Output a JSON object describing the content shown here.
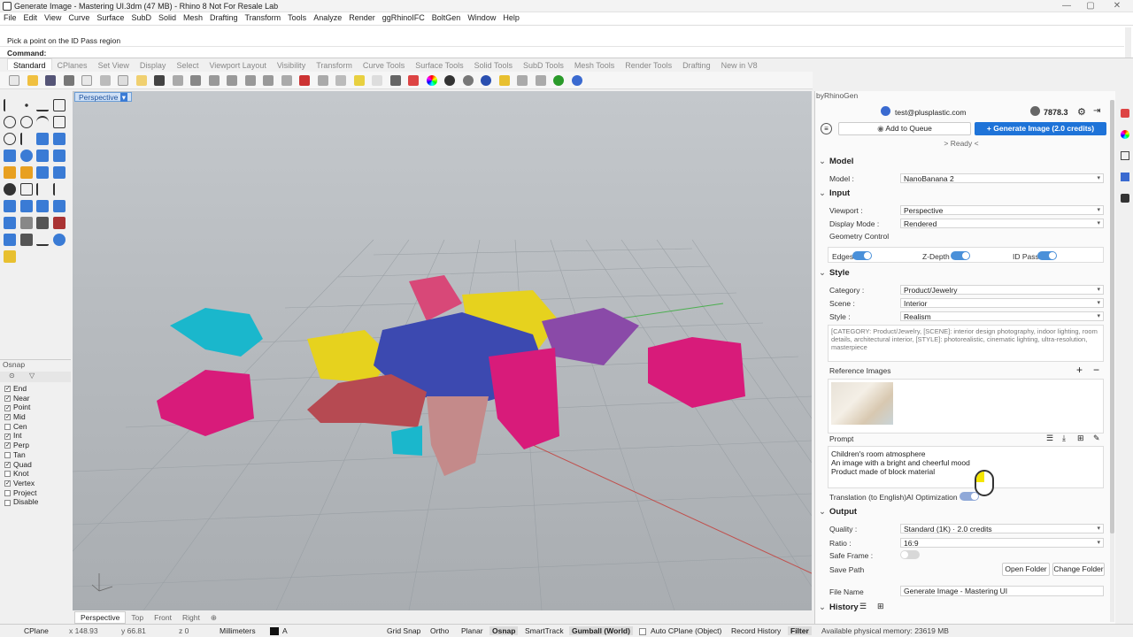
{
  "window": {
    "title": "Generate Image - Mastering UI.3dm (47 MB) - Rhino 8 Not For Resale Lab",
    "controls": [
      "—",
      "▢",
      "✕"
    ]
  },
  "menu": [
    "File",
    "Edit",
    "View",
    "Curve",
    "Surface",
    "SubD",
    "Solid",
    "Mesh",
    "Drafting",
    "Transform",
    "Tools",
    "Analyze",
    "Render",
    "ggRhinoIFC",
    "BoltGen",
    "Window",
    "Help"
  ],
  "command": {
    "prompt_line": "Pick a point on the ID Pass region",
    "label": "Command:",
    "value": ""
  },
  "tabs": [
    "Standard",
    "CPlanes",
    "Set View",
    "Display",
    "Select",
    "Viewport Layout",
    "Visibility",
    "Transform",
    "Curve Tools",
    "Surface Tools",
    "Solid Tools",
    "SubD Tools",
    "Mesh Tools",
    "Render Tools",
    "Drafting",
    "New in V8"
  ],
  "viewport": {
    "name": "Perspective",
    "tabs": [
      "Perspective",
      "Top",
      "Front",
      "Right"
    ]
  },
  "osnap": {
    "title": "Osnap",
    "items": [
      {
        "label": "End",
        "checked": true
      },
      {
        "label": "Near",
        "checked": true
      },
      {
        "label": "Point",
        "checked": true
      },
      {
        "label": "Mid",
        "checked": true
      },
      {
        "label": "Cen",
        "checked": false
      },
      {
        "label": "Int",
        "checked": true
      },
      {
        "label": "Perp",
        "checked": true
      },
      {
        "label": "Tan",
        "checked": false
      },
      {
        "label": "Quad",
        "checked": true
      },
      {
        "label": "Knot",
        "checked": false
      },
      {
        "label": "Vertex",
        "checked": true
      },
      {
        "label": "Project",
        "checked": false
      },
      {
        "label": "Disable",
        "checked": false
      }
    ]
  },
  "status": {
    "cplane": "CPlane",
    "x": "x 148.93",
    "y": "y 66.81",
    "z": "z 0",
    "units": "Millimeters",
    "layer": "A",
    "grid_snap": "Grid Snap",
    "ortho": "Ortho",
    "planar": "Planar",
    "osnap": "Osnap",
    "smarttrack": "SmartTrack",
    "gumball": "Gumball (World)",
    "auto_cplane": "Auto CPlane (Object)",
    "record_history": "Record History",
    "filter": "Filter",
    "memory": "Available physical memory: 23619 MB"
  },
  "panel": {
    "title": "byRhinoGen",
    "account": "test@plusplastic.com",
    "credits": "7878.3",
    "add_queue": "Add to Queue",
    "generate": "Generate Image (2.0 credits)",
    "status": "> Ready <",
    "model_section": "Model",
    "model_label": "Model :",
    "model_value": "NanoBanana 2",
    "input_section": "Input",
    "viewport_label": "Viewport :",
    "viewport_value": "Perspective",
    "display_label": "Display Mode :",
    "display_value": "Rendered",
    "geometry_control": "Geometry Control",
    "edges": "Edges",
    "zdepth": "Z-Depth",
    "idpass": "ID Pass",
    "style_section": "Style",
    "category_label": "Category :",
    "category_value": "Product/Jewelry",
    "scene_label": "Scene :",
    "scene_value": "Interior",
    "style_label": "Style :",
    "style_value": "Realism",
    "style_prompt": "[CATEGORY: Product/Jewelry, [SCENE]: interior design photography, indoor lighting, room details, architectural interior, [STYLE]: photorealistic, cinematic lighting, ultra-resolution, masterpiece",
    "reference_images": "Reference Images",
    "prompt_label": "Prompt",
    "prompt_lines": [
      "Children's room atmosphere",
      "An image with a bright and cheerful mood",
      "Product made of block material"
    ],
    "translation": "Translation (to English)",
    "ai_opt": "AI Optimization",
    "output_section": "Output",
    "quality_label": "Quality :",
    "quality_value": "Standard (1K) · 2.0 credits",
    "ratio_label": "Ratio :",
    "ratio_value": "16:9",
    "safe_frame": "Safe Frame :",
    "save_path": "Save Path",
    "open_folder": "Open Folder",
    "change_folder": "Change Folder",
    "file_name_label": "File Name",
    "file_name_value": "Generate Image - Mastering UI",
    "history_section": "History"
  }
}
